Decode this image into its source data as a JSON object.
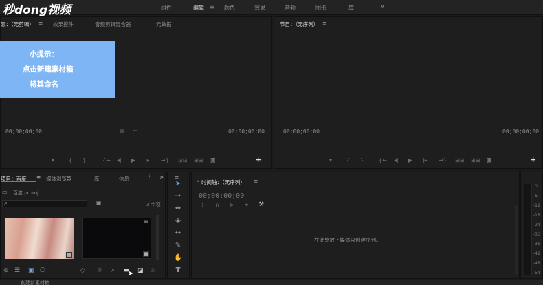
{
  "app": {
    "logo_text": "秒dong视频"
  },
  "workspaces": [
    "组件",
    "编辑",
    "颜色",
    "效果",
    "音频",
    "图形",
    "库"
  ],
  "workspace_more": "»",
  "source_panel": {
    "tabs": [
      "源：（无剪辑）",
      "效果控件",
      "音频剪辑混合器",
      "元数据"
    ],
    "timecode_left": "00;00;00;00",
    "timecode_right": "00;00;00;00"
  },
  "program_panel": {
    "tab": "节目：（无序列）",
    "timecode_left": "00;00;00;00",
    "timecode_right": "00;00;00;00"
  },
  "hint": {
    "line1": "小提示：",
    "line2": "点击新建素材箱",
    "line3": "将其命名"
  },
  "project_panel": {
    "tabs": [
      "项目：百度",
      "媒体浏览器",
      "库",
      "信息"
    ],
    "file_name": "百度.prproj",
    "item_count": "3 个项"
  },
  "timeline_panel": {
    "tab": "时间轴：（无序列）",
    "timecode": "00;00;00;00",
    "empty_message": "在此处放下媒体以创建序列。"
  },
  "audio_meter": {
    "labels": [
      "0",
      "-6",
      "-12",
      "-18",
      "-24",
      "-30",
      "-36",
      "-42",
      "-48",
      "-54"
    ]
  },
  "status_bar": {
    "text": "创建新素材箱"
  }
}
